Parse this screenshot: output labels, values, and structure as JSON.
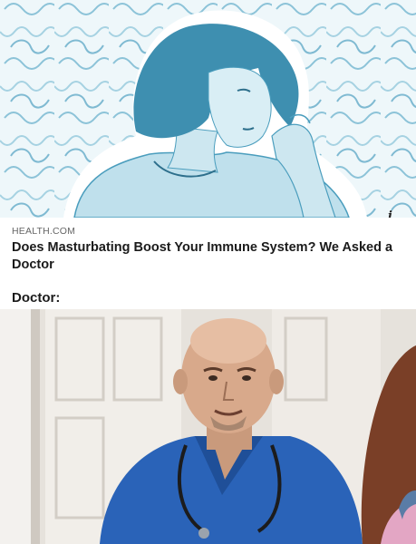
{
  "post": {
    "source": "HEALTH.COM",
    "headline": "Does Masturbating Boost Your Immune System? We Asked a Doctor",
    "info_glyph": "i"
  },
  "caption": "Doctor:",
  "colors": {
    "hero_tint": "#3e8fb0",
    "hero_bg": "#e9f4f8",
    "scrubs": "#2a63b8",
    "text": "#1b1b1b",
    "source_text": "#666666"
  },
  "icons": {
    "info": "info-icon"
  }
}
